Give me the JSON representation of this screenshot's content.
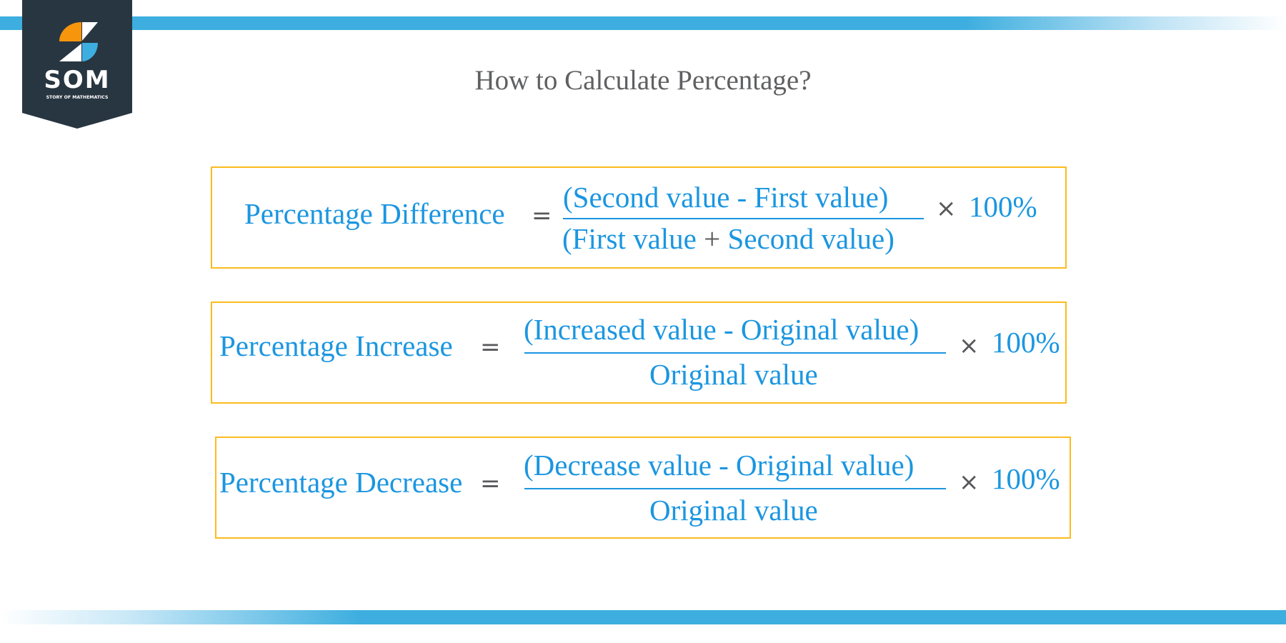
{
  "brand": {
    "wordmark": "SOM",
    "tagline": "STORY OF MATHEMATICS",
    "colors": {
      "dark": "#283641",
      "orange": "#f7950c",
      "blue": "#3daedf",
      "white": "#ffffff"
    }
  },
  "title": "How to Calculate Percentage?",
  "formulas": [
    {
      "label": "Percentage Difference",
      "equals": "=",
      "numerator": "(Second value - First value)",
      "denominator_parts": [
        "(First value ",
        "+",
        " Second value)"
      ],
      "times": "×",
      "multiplier": "100%"
    },
    {
      "label": "Percentage Increase",
      "equals": "=",
      "numerator": "(Increased value - Original value)",
      "denominator": "Original value",
      "times": "×",
      "multiplier": "100%"
    },
    {
      "label": "Percentage Decrease",
      "equals": "=",
      "numerator": "(Decrease value - Original value)",
      "denominator": "Original value",
      "times": "×",
      "multiplier": "100%"
    }
  ],
  "colors": {
    "formula_text": "#1b96e0",
    "operator": "#58595b",
    "box_border": "#fbbc1d",
    "title": "#5f6062",
    "accent_bar": "#3daedf"
  }
}
